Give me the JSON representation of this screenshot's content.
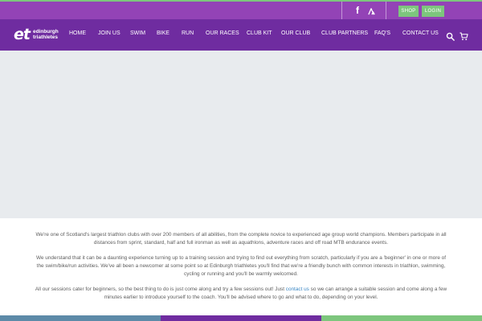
{
  "colors": {
    "accent_green": "#7dc67d",
    "topbar_purple": "#9343b6",
    "nav_purple": "#6f2ca0",
    "hero_gray": "#e8ebee",
    "link_blue": "#3c88c5",
    "footer_bar_1": "#5d8aa8",
    "footer_bar_2": "#6f2ca0",
    "footer_bar_3": "#7dc67d"
  },
  "topbar": {
    "icons": [
      "facebook-icon",
      "strava-icon"
    ],
    "shop_label": "SHOP",
    "login_label": "LOGIN"
  },
  "logo": {
    "mark": "et",
    "line1": "edinburgh",
    "line2": "triathletes"
  },
  "nav": {
    "items": [
      "HOME",
      "JOIN US",
      "SWIM",
      "BIKE",
      "RUN",
      "OUR RACES",
      "CLUB KIT",
      "OUR CLUB",
      "CLUB PARTNERS",
      "FAQ'S",
      "CONTACT US"
    ],
    "icons": [
      "search-icon",
      "cart-icon"
    ]
  },
  "intro": {
    "p1": "We're one of Scotland's largest triathlon clubs with over 200 members of all abilities, from the complete novice to experienced age group world champions. Members participate in all distances from sprint, standard, half and full ironman as well as aquathlons, adventure races and off road MTB endurance events.",
    "p2": "We understand that it can be a daunting experience turning up to a training session and trying to find out everything from scratch, particularly if you are a 'beginner' in one or more of the swim/bike/run activities. We've all been a newcomer at some point so at Edinburgh triathletes you'll find that we're a friendly bunch with common interests in triathlon, swimming, cycling or running and you'll be warmly welcomed.",
    "p3_before": "All our sessions cater for beginners, so the best thing to do is just come along and try a few sessions out! Just ",
    "p3_link": "contact us",
    "p3_after": " so we can arrange a suitable session and come along a few minutes earlier to introduce yourself to the coach. You'll be advised where to go and what to do, depending on your level."
  }
}
